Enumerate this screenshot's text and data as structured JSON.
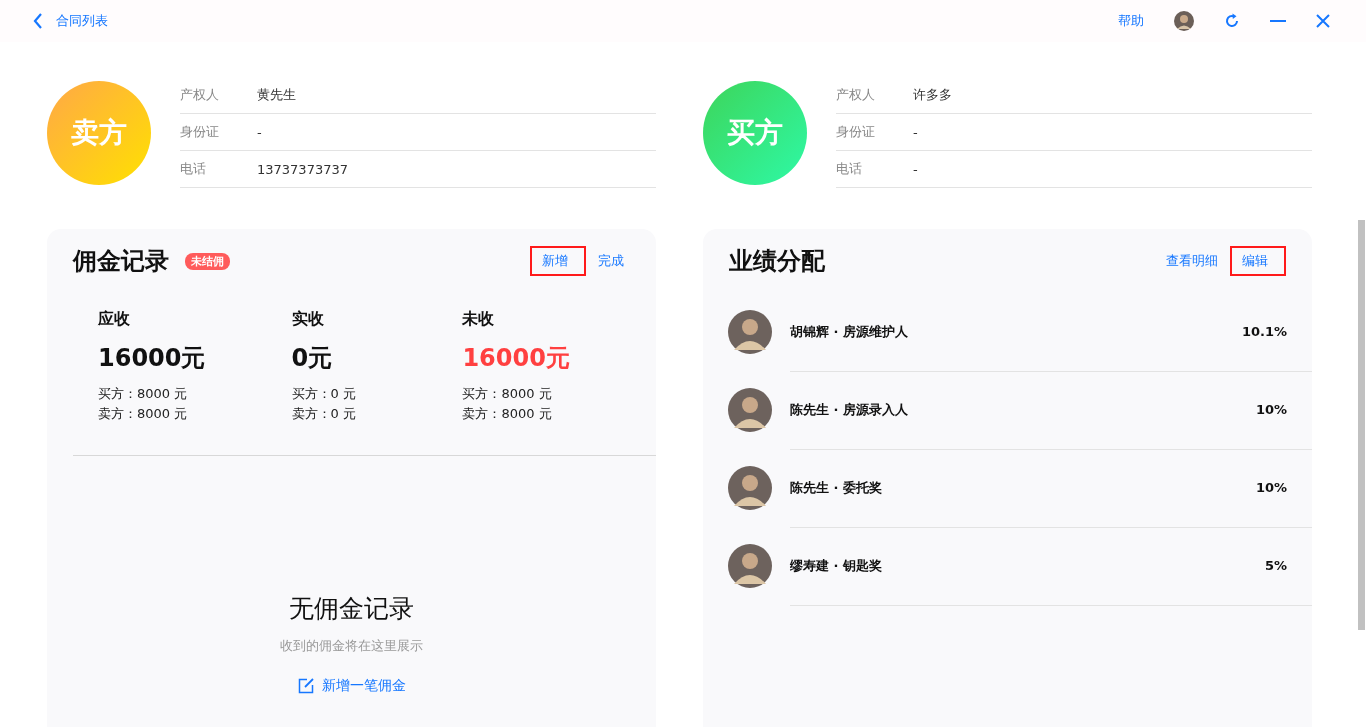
{
  "topbar": {
    "back_label": "合同列表",
    "help": "帮助"
  },
  "parties": [
    {
      "role": "卖方",
      "kind": "seller",
      "fields": [
        {
          "label": "产权人",
          "value": "黄先生"
        },
        {
          "label": "身份证",
          "value": "-"
        },
        {
          "label": "电话",
          "value": "13737373737"
        }
      ]
    },
    {
      "role": "买方",
      "kind": "buyer",
      "fields": [
        {
          "label": "产权人",
          "value": "许多多"
        },
        {
          "label": "身份证",
          "value": "-"
        },
        {
          "label": "电话",
          "value": "-"
        }
      ]
    }
  ],
  "commission": {
    "title": "佣金记录",
    "badge": "未结佣",
    "actions": [
      {
        "label": "新增",
        "highlighted": true
      },
      {
        "label": "完成",
        "highlighted": false
      }
    ],
    "stats": [
      {
        "label": "应收",
        "amount": "16000元",
        "alert": false,
        "lines": [
          "买方：8000 元",
          "卖方：8000 元"
        ]
      },
      {
        "label": "实收",
        "amount": "0元",
        "alert": false,
        "lines": [
          "买方：0 元",
          "卖方：0 元"
        ]
      },
      {
        "label": "未收",
        "amount": "16000元",
        "alert": true,
        "lines": [
          "买方：8000 元",
          "卖方：8000 元"
        ]
      }
    ],
    "empty": {
      "title": "无佣金记录",
      "subtitle": "收到的佣金将在这里展示",
      "action": "新增一笔佣金"
    }
  },
  "performance": {
    "title": "业绩分配",
    "actions": [
      {
        "label": "查看明细",
        "highlighted": false
      },
      {
        "label": "编辑",
        "highlighted": true
      }
    ],
    "rows": [
      {
        "name": "胡锦辉 · 房源维护人",
        "share": "10.1%"
      },
      {
        "name": "陈先生 · 房源录入人",
        "share": "10%"
      },
      {
        "name": "陈先生 · 委托奖",
        "share": "10%"
      },
      {
        "name": "缪寿建 · 钥匙奖",
        "share": "5%"
      }
    ]
  }
}
